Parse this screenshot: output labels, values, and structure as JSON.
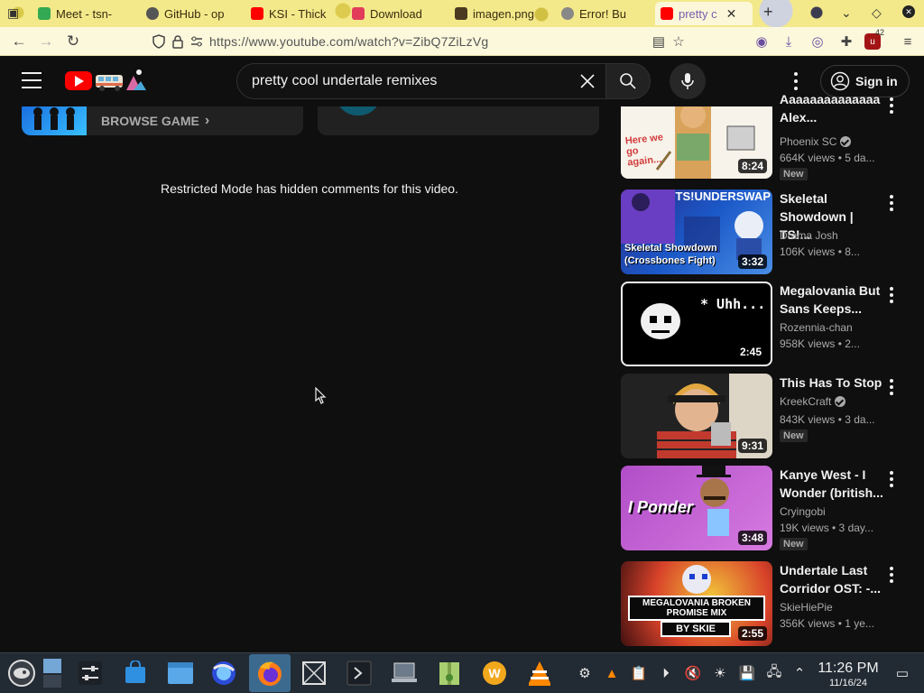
{
  "browser": {
    "tabs": [
      {
        "label": "Meet - tsn-",
        "favicon_color": "#34a853"
      },
      {
        "label": "GitHub - op",
        "favicon_color": "#555555"
      },
      {
        "label": "KSI - Thick",
        "favicon_color": "#ff0000"
      },
      {
        "label": "Download",
        "favicon_color": "#e23c5a"
      },
      {
        "label": "imagen.png",
        "favicon_color": "#4a3a20"
      },
      {
        "label": "Error! Bu",
        "favicon_color": "#888888"
      },
      {
        "label": "pretty c",
        "favicon_color": "#ff0000"
      }
    ],
    "url": "https://www.youtube.com/watch?v=ZibQ7ZiLzVg",
    "extension_badge": "42"
  },
  "header": {
    "search_query": "pretty cool undertale remixes",
    "signin_label": "Sign in"
  },
  "main": {
    "browse_game_label": "BROWSE GAME",
    "restricted_notice": "Restricted Mode has hidden comments for this video."
  },
  "recommendations": [
    {
      "title": "Alex...",
      "title_prefix": "Aaaaaaaaaaaaaa",
      "channel": "Phoenix SC",
      "verified": true,
      "meta": "664K views • 5 da...",
      "new": "New",
      "duration": "8:24",
      "thumb_text": "Here we go again..."
    },
    {
      "title": "Skeletal Showdown | TS!...",
      "channel": "Drama Josh",
      "verified": false,
      "meta": "106K views • 8...",
      "new": "",
      "duration": "3:32",
      "thumb_text": "Skeletal Showdown (Crossbones Fight)",
      "thumb_top": "TS!UNDERSWAP"
    },
    {
      "title": "Megalovania But Sans Keeps...",
      "channel": "Rozennia-chan",
      "verified": false,
      "meta": "958K views • 2...",
      "new": "",
      "duration": "2:45",
      "thumb_text": "* Uhh..."
    },
    {
      "title": "This Has To Stop",
      "channel": "KreekCraft",
      "verified": true,
      "meta": "843K views • 3 da...",
      "new": "New",
      "duration": "9:31"
    },
    {
      "title": "Kanye West - I Wonder (british...",
      "channel": "Cryingobi",
      "verified": false,
      "meta": "19K views • 3 day...",
      "new": "New",
      "duration": "3:48",
      "thumb_text": "I Ponder"
    },
    {
      "title": "Undertale Last Corridor OST: -...",
      "channel": "SkieHiePie",
      "verified": false,
      "meta": "356K views • 1 ye...",
      "new": "",
      "duration": "2:55",
      "thumb_text": "MEGALOVANIA BROKEN PROMISE MIX",
      "thumb_sub": "BY SKIE"
    }
  ],
  "taskbar": {
    "time": "11:26 PM",
    "date": "11/16/24"
  },
  "colors": {
    "yt_bg": "#0f0f0f",
    "yt_red": "#ff0000",
    "taskbar_bg": "#222a33"
  }
}
